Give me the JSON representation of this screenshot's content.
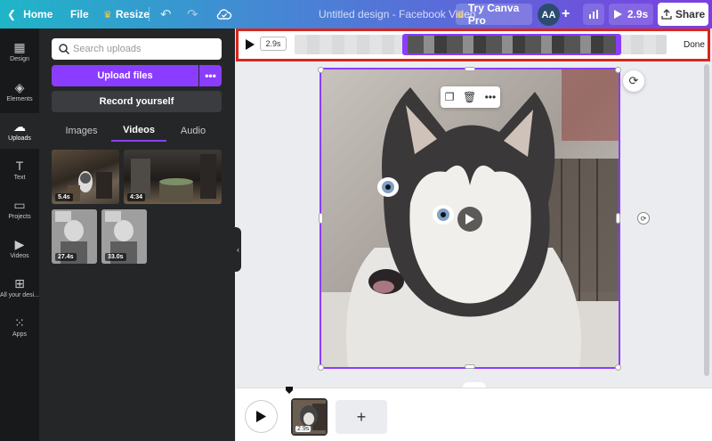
{
  "topbar": {
    "home_label": "Home",
    "file_label": "File",
    "resize_label": "Resize",
    "title": "Untitled design - Facebook Video",
    "pro_label": "Try Canva Pro",
    "avatar_initials": "AA",
    "play_time": "2.9s",
    "share_label": "Share"
  },
  "rail": {
    "items": [
      {
        "label": "Design",
        "icon": "layout-icon"
      },
      {
        "label": "Elements",
        "icon": "shapes-icon"
      },
      {
        "label": "Uploads",
        "icon": "cloud-upload-icon"
      },
      {
        "label": "Text",
        "icon": "text-icon"
      },
      {
        "label": "Projects",
        "icon": "folder-icon"
      },
      {
        "label": "Videos",
        "icon": "video-icon"
      },
      {
        "label": "All your desi...",
        "icon": "grid-icon"
      },
      {
        "label": "Apps",
        "icon": "apps-icon"
      }
    ]
  },
  "panel": {
    "search_placeholder": "Search uploads",
    "upload_label": "Upload files",
    "upload_more_label": "•••",
    "record_label": "Record yourself",
    "tabs": [
      "Images",
      "Videos",
      "Audio"
    ],
    "active_tab": "Videos",
    "videos": [
      {
        "duration": "5.4s"
      },
      {
        "duration": "4:34"
      },
      {
        "duration": "27.4s"
      },
      {
        "duration": "33.0s"
      }
    ]
  },
  "trim": {
    "time": "2.9s",
    "done_label": "Done"
  },
  "timeline": {
    "clip_duration": "2.9s",
    "add_label": "+"
  },
  "colors": {
    "accent": "#8b3dff",
    "highlight": "#d9261c",
    "panel_bg": "#252627",
    "rail_bg": "#18191b"
  }
}
